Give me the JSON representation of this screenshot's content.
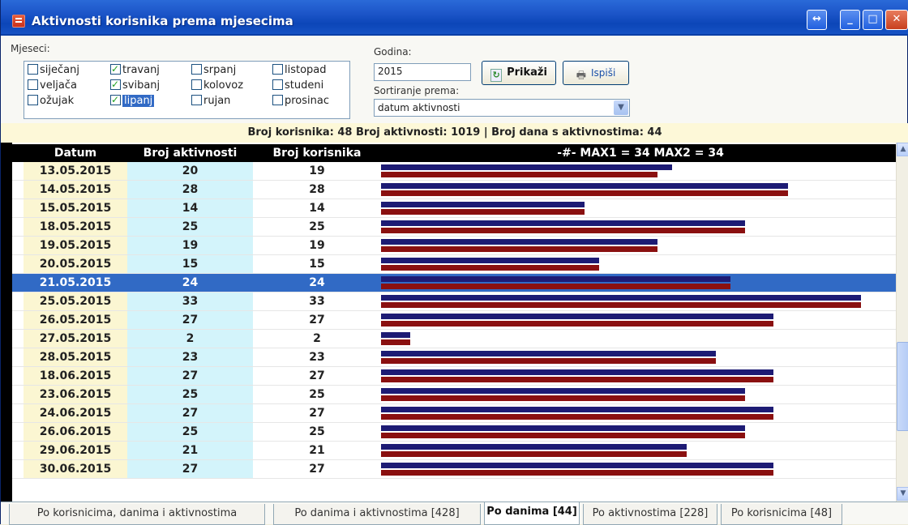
{
  "window": {
    "title": "Aktivnosti korisnika prema mjesecima"
  },
  "titlebar_buttons": {
    "restore_arrows": "↔",
    "minimize": "_",
    "maximize": "□",
    "close": "✕"
  },
  "months": {
    "label": "Mjeseci:",
    "items": [
      {
        "label": "siječanj",
        "checked": false,
        "selected": false
      },
      {
        "label": "veljača",
        "checked": false,
        "selected": false
      },
      {
        "label": "ožujak",
        "checked": false,
        "selected": false
      },
      {
        "label": "travanj",
        "checked": true,
        "selected": false
      },
      {
        "label": "svibanj",
        "checked": true,
        "selected": false
      },
      {
        "label": "lipanj",
        "checked": true,
        "selected": true
      },
      {
        "label": "srpanj",
        "checked": false,
        "selected": false
      },
      {
        "label": "kolovoz",
        "checked": false,
        "selected": false
      },
      {
        "label": "rujan",
        "checked": false,
        "selected": false
      },
      {
        "label": "listopad",
        "checked": false,
        "selected": false
      },
      {
        "label": "studeni",
        "checked": false,
        "selected": false
      },
      {
        "label": "prosinac",
        "checked": false,
        "selected": false
      }
    ]
  },
  "godina": {
    "label": "Godina:",
    "value": "2015"
  },
  "buttons": {
    "prikazi": "Prikaži",
    "ispisi": "Ispiši"
  },
  "sort": {
    "label": "Sortiranje prema:",
    "value": "datum aktivnosti"
  },
  "summary": "Broj korisnika: 48  Broj aktivnosti: 1019 | Broj dana s aktivnostima: 44",
  "grid": {
    "headers": {
      "datum": "Datum",
      "akt": "Broj aktivnosti",
      "kor": "Broj korisnika",
      "graf": "-#- MAX1 = 34  MAX2 = 34"
    },
    "max1": 34,
    "max2": 34,
    "rows": [
      {
        "datum": "13.05.2015",
        "akt": "20",
        "kor": "19",
        "selected": false
      },
      {
        "datum": "14.05.2015",
        "akt": "28",
        "kor": "28",
        "selected": false
      },
      {
        "datum": "15.05.2015",
        "akt": "14",
        "kor": "14",
        "selected": false
      },
      {
        "datum": "18.05.2015",
        "akt": "25",
        "kor": "25",
        "selected": false
      },
      {
        "datum": "19.05.2015",
        "akt": "19",
        "kor": "19",
        "selected": false
      },
      {
        "datum": "20.05.2015",
        "akt": "15",
        "kor": "15",
        "selected": false
      },
      {
        "datum": "21.05.2015",
        "akt": "24",
        "kor": "24",
        "selected": true
      },
      {
        "datum": "25.05.2015",
        "akt": "33",
        "kor": "33",
        "selected": false
      },
      {
        "datum": "26.05.2015",
        "akt": "27",
        "kor": "27",
        "selected": false
      },
      {
        "datum": "27.05.2015",
        "akt": "2",
        "kor": "2",
        "selected": false
      },
      {
        "datum": "28.05.2015",
        "akt": "23",
        "kor": "23",
        "selected": false
      },
      {
        "datum": "18.06.2015",
        "akt": "27",
        "kor": "27",
        "selected": false
      },
      {
        "datum": "23.06.2015",
        "akt": "25",
        "kor": "25",
        "selected": false
      },
      {
        "datum": "24.06.2015",
        "akt": "27",
        "kor": "27",
        "selected": false
      },
      {
        "datum": "26.06.2015",
        "akt": "25",
        "kor": "25",
        "selected": false
      },
      {
        "datum": "29.06.2015",
        "akt": "21",
        "kor": "21",
        "selected": false
      },
      {
        "datum": "30.06.2015",
        "akt": "27",
        "kor": "27",
        "selected": false
      }
    ]
  },
  "tabs": [
    {
      "label": "Po korisnicima, danima i aktivnostima",
      "active": false
    },
    {
      "label": "Po danima i aktivnostima [428]",
      "active": false
    },
    {
      "label": "Po danima [44]",
      "active": true
    },
    {
      "label": "Po aktivnostima [228]",
      "active": false
    },
    {
      "label": "Po korisnicima [48]",
      "active": false
    }
  ],
  "colors": {
    "bar1": "#1d1b74",
    "bar2": "#8a1010",
    "selection": "#316ac5"
  }
}
